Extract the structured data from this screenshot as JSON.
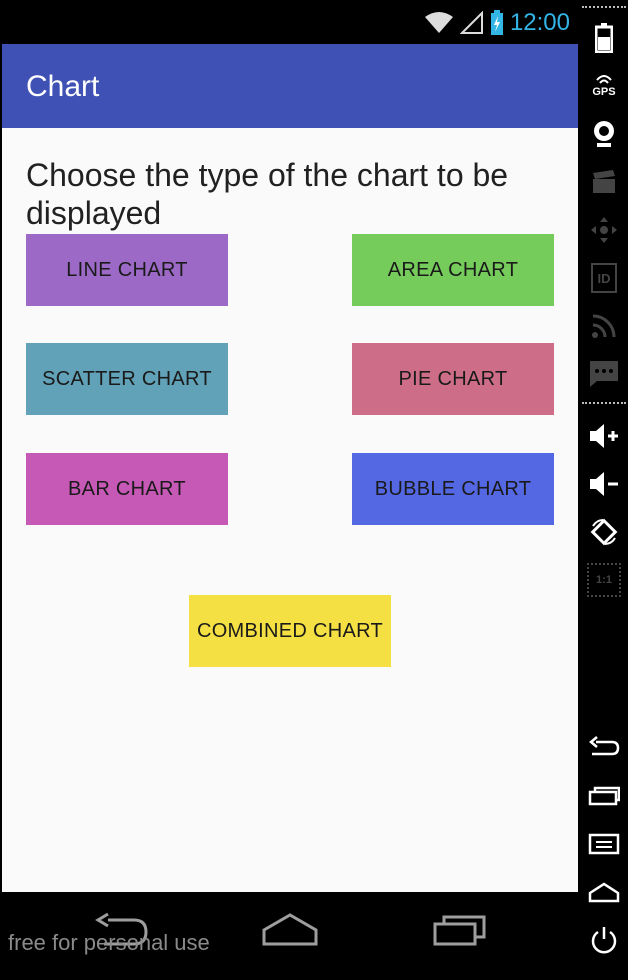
{
  "status_bar": {
    "time": "12:00"
  },
  "app_bar": {
    "title": "Chart",
    "color": "#3f51b5"
  },
  "content": {
    "prompt": "Choose the type of the chart to be displayed",
    "buttons": [
      {
        "label": "LINE CHART",
        "color": "#9c6ac6"
      },
      {
        "label": "AREA CHART",
        "color": "#76cc5a"
      },
      {
        "label": "SCATTER CHART",
        "color": "#61a2b8"
      },
      {
        "label": "PIE CHART",
        "color": "#cd6d87"
      },
      {
        "label": "BAR CHART",
        "color": "#c659b6"
      },
      {
        "label": "BUBBLE CHART",
        "color": "#5468e4"
      },
      {
        "label": "COMBINED CHART",
        "color": "#f5e043"
      }
    ]
  },
  "watermark": "free for personal use",
  "emulator_toolbar": {
    "gps_label": "GPS",
    "id_label": "ID",
    "scale_label": "1:1",
    "icons": [
      "battery-icon",
      "gps-icon",
      "camera-icon",
      "video-icon",
      "dpad-icon",
      "id-icon",
      "rss-icon",
      "sms-icon",
      "volume-up-icon",
      "volume-down-icon",
      "rotate-icon",
      "scale-icon",
      "back-icon",
      "home-icon",
      "menu-icon",
      "overview-icon",
      "power-icon"
    ]
  }
}
